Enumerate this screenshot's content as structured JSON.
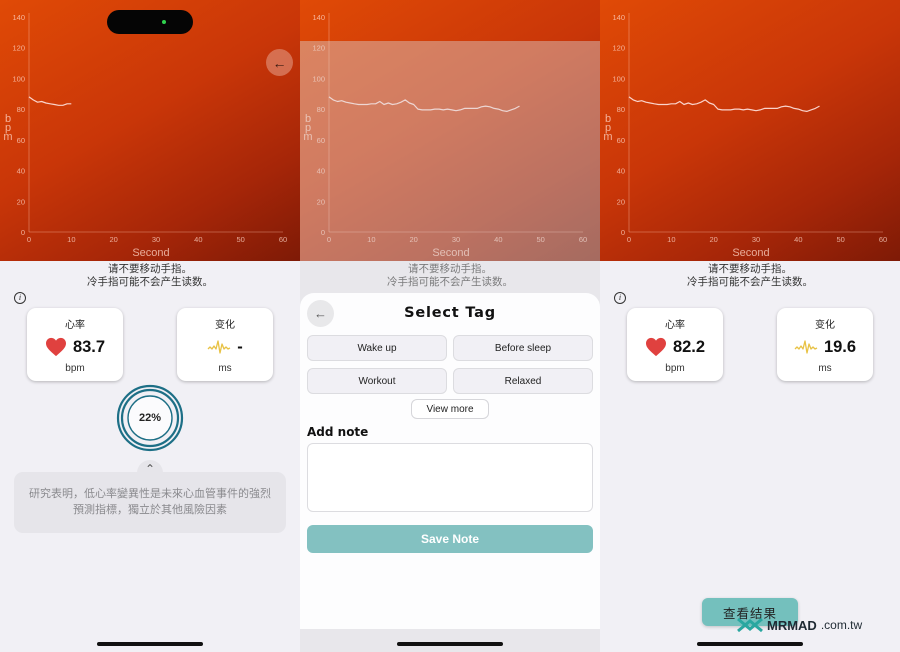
{
  "screens": [
    {
      "id": "measuring",
      "chart": {
        "ylabel": "bpm",
        "xlabel": "Second",
        "yticks": [
          "0",
          "20",
          "40",
          "60",
          "80",
          "100",
          "120",
          "140"
        ],
        "xticks": [
          "0",
          "10",
          "20",
          "30",
          "40",
          "50",
          "60"
        ],
        "back_icon": "←"
      },
      "hint_line1": "请不要移动手指。",
      "hint_line2": "冷手指可能不会产生读数。",
      "info_icon": "i",
      "heart_rate": {
        "title": "心率",
        "value": "83.7",
        "unit": "bpm"
      },
      "variability": {
        "title": "变化",
        "value": "-",
        "unit": "ms"
      },
      "progress": {
        "label": "22%",
        "value": 0.22
      },
      "chevron_icon": "⌃",
      "fact": "研究表明，低心率變異性是未來心血管事件的強烈預測指標，獨立於其他風險因素"
    },
    {
      "id": "select-tag",
      "chart": {
        "ylabel": "bpm",
        "xlabel": "Second",
        "yticks": [
          "0",
          "20",
          "40",
          "60",
          "80",
          "100",
          "120",
          "140"
        ],
        "xticks": [
          "0",
          "10",
          "20",
          "30",
          "40",
          "50",
          "60"
        ]
      },
      "hint_line1": "请不要移动手指。",
      "hint_line2": "冷手指可能不会产生读数。",
      "sheet": {
        "back_icon": "←",
        "title": "Select Tag",
        "tags": [
          "Wake up",
          "Before sleep",
          "Workout",
          "Relaxed"
        ],
        "view_more": "View more",
        "add_note_label": "Add note",
        "note_value": "",
        "note_placeholder": "",
        "save_label": "Save Note"
      }
    },
    {
      "id": "result",
      "chart": {
        "ylabel": "bpm",
        "xlabel": "Second",
        "yticks": [
          "0",
          "20",
          "40",
          "60",
          "80",
          "100",
          "120",
          "140"
        ],
        "xticks": [
          "0",
          "10",
          "20",
          "30",
          "40",
          "50",
          "60"
        ]
      },
      "hint_line1": "请不要移动手指。",
      "hint_line2": "冷手指可能不会产生读数。",
      "info_icon": "i",
      "heart_rate": {
        "title": "心率",
        "value": "82.2",
        "unit": "bpm"
      },
      "variability": {
        "title": "变化",
        "value": "19.6",
        "unit": "ms"
      },
      "view_result": "查看结果",
      "watermark": {
        "brand": "MRMAD",
        "domain": ".com.tw"
      }
    }
  ],
  "colors": {
    "accent_teal": "#83c1c1",
    "heart_red": "#e0413f",
    "wave_yellow": "#e8c245",
    "ring_teal": "#1d6f86"
  },
  "chart_data": {
    "type": "line",
    "title": "",
    "xlabel": "Second",
    "ylabel": "bpm",
    "xlim": [
      0,
      60
    ],
    "ylim": [
      0,
      140
    ],
    "grid": false,
    "series": [
      {
        "name": "measuring",
        "x": [
          0,
          1,
          2,
          3,
          4,
          5,
          6,
          7,
          8,
          9,
          10
        ],
        "y": [
          88,
          86,
          84.5,
          85,
          84,
          83.5,
          83,
          82.5,
          82.5,
          83.5,
          83.5
        ]
      },
      {
        "name": "full",
        "x": [
          0,
          1,
          2,
          3,
          4,
          5,
          6,
          7,
          8,
          9,
          10,
          11,
          12,
          13,
          14,
          15,
          16,
          17,
          18,
          19,
          20,
          21,
          22,
          23,
          24,
          25,
          26,
          27,
          28,
          29,
          30,
          31,
          32,
          33,
          34,
          35,
          36,
          37,
          38,
          39,
          40,
          41,
          42,
          43,
          44,
          45
        ],
        "y": [
          88,
          86,
          85,
          85.5,
          84.5,
          84,
          83.5,
          83,
          83,
          83,
          83.5,
          83.5,
          85,
          83,
          84,
          83,
          83.5,
          84.5,
          86,
          84,
          83,
          80,
          79.5,
          79.5,
          79.5,
          80,
          80,
          79.5,
          80,
          79.5,
          79,
          79.5,
          80.5,
          80.5,
          80.5,
          80.5,
          81.5,
          82,
          81.5,
          80.5,
          80,
          79,
          78.5,
          79.5,
          80.5,
          82
        ]
      }
    ]
  }
}
